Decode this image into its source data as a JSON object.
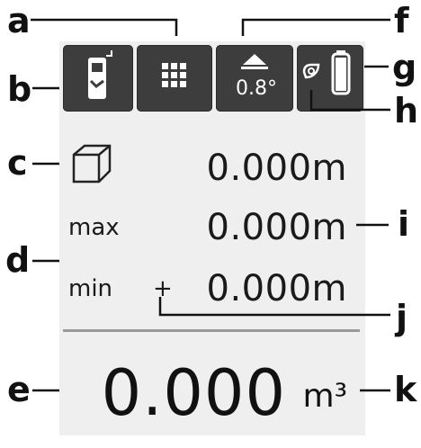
{
  "callouts": {
    "a": "a",
    "b": "b",
    "c": "c",
    "d": "d",
    "e": "e",
    "f": "f",
    "g": "g",
    "h": "h",
    "i": "i",
    "j": "j",
    "k": "k"
  },
  "toolbar": {
    "tilt_value": "0.8°"
  },
  "readings": {
    "area_value": "0.000m",
    "max_label": "max",
    "max_value": "0.000m",
    "min_label": "min",
    "min_plus": "+",
    "min_value": "0.000m"
  },
  "result": {
    "value": "0.000",
    "unit": "m³"
  },
  "colors": {
    "button_bg": "#3d3d3d",
    "screen_bg": "#efefef",
    "callout_line": "#111111"
  }
}
